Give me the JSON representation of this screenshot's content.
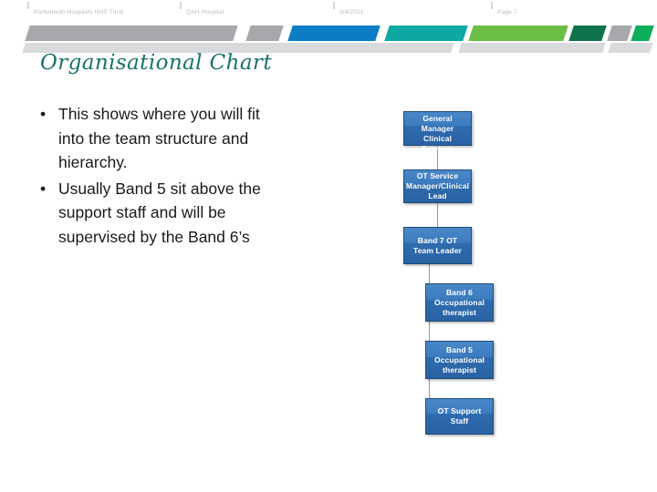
{
  "slide": {
    "title": "Organisational Chart",
    "title_color": "#17736b"
  },
  "header": {
    "footer_text": "Portsmouth Hospitals NHS Trust",
    "location_text": "QAH Hospital",
    "date_text": "3/4/2021",
    "page_text": "Page 7"
  },
  "banner": {
    "colors": {
      "gray": "#a6a8ab",
      "blue": "#0c7dc4",
      "teal": "#0ea8a4",
      "green": "#6cbe45",
      "dark_green": "#10724a",
      "gray2": "#a6a8ab",
      "green2": "#0fae5a",
      "lower_gray": "#d9dadc"
    }
  },
  "body": {
    "bullets": [
      "This shows where you will fit into the team structure and hierarchy.",
      "Usually Band 5 sit above the support staff and will be supervised by the Band 6’s"
    ],
    "bullet_glyph": "•"
  },
  "chart_data": {
    "type": "diagram",
    "title": "Organisational Chart",
    "orientation": "vertical-hierarchy",
    "nodes": [
      {
        "id": "n1",
        "label": "Divisional General Manager Clinical Services",
        "level": 0
      },
      {
        "id": "n2",
        "label": "OT Service Manager/Clinical Lead",
        "level": 1
      },
      {
        "id": "n3",
        "label": "Band 7 OT Team Leader",
        "level": 2
      },
      {
        "id": "n4",
        "label": "Band 6 Occupational therapist",
        "level": 3
      },
      {
        "id": "n5",
        "label": "Band 5 Occupational therapist",
        "level": 4
      },
      {
        "id": "n6",
        "label": "OT Support Staff",
        "level": 5
      }
    ],
    "edges": [
      {
        "from": "n1",
        "to": "n2"
      },
      {
        "from": "n2",
        "to": "n3"
      },
      {
        "from": "n3",
        "to": "n4"
      },
      {
        "from": "n3",
        "to": "n5"
      },
      {
        "from": "n3",
        "to": "n6"
      }
    ],
    "node_fill": "#2f6cae",
    "node_border": "#1f4e79",
    "node_text_color": "#ffffff"
  }
}
